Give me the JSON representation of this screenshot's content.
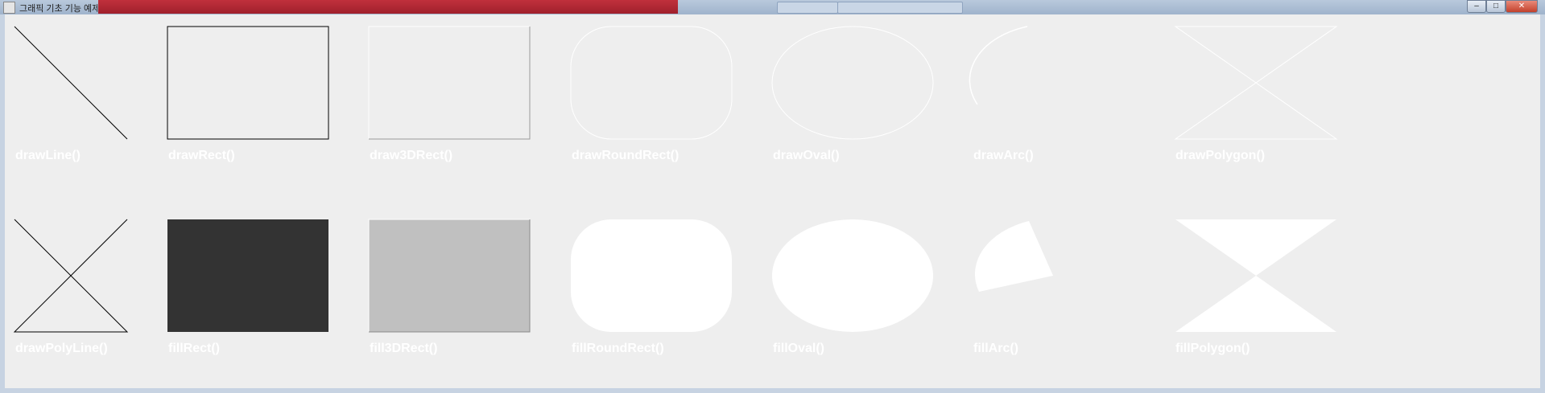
{
  "window": {
    "title": "그래픽 기초 기능 예제",
    "taskbar_items": [
      "",
      ""
    ],
    "buttons": [
      "‒",
      "□",
      "✕"
    ]
  },
  "colors": {
    "background": "#eeeeee",
    "outline_white": "#ffffff",
    "outline_black": "#000000",
    "fill_dark": "#333333",
    "fill_gray": "#c0c0c0",
    "fill_white": "#ffffff",
    "label": "#ffffff"
  },
  "icons": [
    "app-icon",
    "minimize-icon",
    "maximize-icon",
    "close-icon"
  ],
  "demos": {
    "row1": [
      {
        "key": "drawLine",
        "label": "drawLine()"
      },
      {
        "key": "drawRect",
        "label": "drawRect()"
      },
      {
        "key": "draw3DRect",
        "label": "draw3DRect()"
      },
      {
        "key": "drawRoundRect",
        "label": "drawRoundRect()"
      },
      {
        "key": "drawOval",
        "label": "drawOval()"
      },
      {
        "key": "drawArc",
        "label": "drawArc()"
      },
      {
        "key": "drawPolygon",
        "label": "drawPolygon()"
      }
    ],
    "row2": [
      {
        "key": "drawPolyLine",
        "label": "drawPolyLine()"
      },
      {
        "key": "fillRect",
        "label": "fillRect()"
      },
      {
        "key": "fill3DRect",
        "label": "fill3DRect()"
      },
      {
        "key": "fillRoundRect",
        "label": "fillRoundRect()"
      },
      {
        "key": "fillOval",
        "label": "fillOval()"
      },
      {
        "key": "fillArc",
        "label": "fillArc()"
      },
      {
        "key": "fillPolygon",
        "label": "fillPolygon()"
      }
    ]
  }
}
